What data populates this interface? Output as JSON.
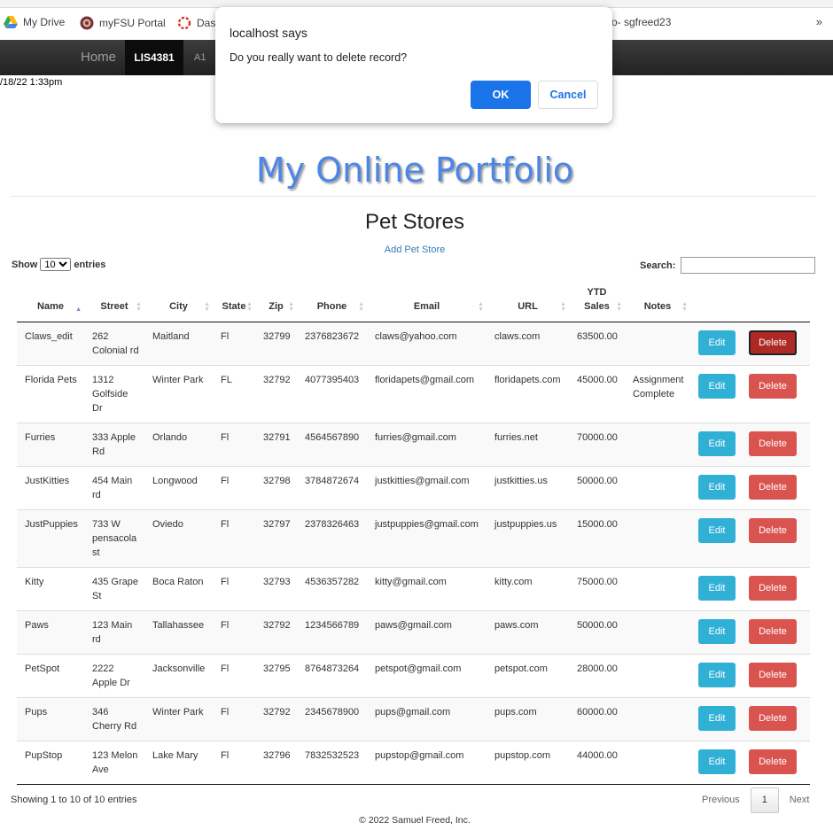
{
  "browser": {
    "bookmarks": [
      {
        "label": "My Drive",
        "icon": "google-drive-icon"
      },
      {
        "label": "myFSU Portal",
        "icon": "fsu-seal-icon"
      },
      {
        "label": "Das",
        "icon": "loading-ring-icon"
      }
    ],
    "bookmark_right_label": "o- sgfreed23",
    "overflow": "»"
  },
  "nav": {
    "home": "Home",
    "active": "LIS4381",
    "a1": "A1"
  },
  "timestamp": "/18/22 1:33pm",
  "dialog": {
    "title": "localhost says",
    "message": "Do you really want to delete record?",
    "ok": "OK",
    "cancel": "Cancel"
  },
  "brand": "My Online Portfolio",
  "page_heading": "Pet Stores",
  "add_link": "Add Pet Store",
  "length": {
    "show": "Show",
    "value": "10",
    "entries": "entries"
  },
  "search": {
    "label": "Search:",
    "value": ""
  },
  "table": {
    "columns": [
      "Name",
      "Street",
      "City",
      "State",
      "Zip",
      "Phone",
      "Email",
      "URL",
      "YTD Sales",
      "Notes"
    ],
    "sorted_column": "Name",
    "edit_label": "Edit",
    "delete_label": "Delete",
    "rows": [
      {
        "name": "Claws_edit",
        "street": "262 Colonial rd",
        "city": "Maitland",
        "state": "Fl",
        "zip": "32799",
        "phone": "2376823672",
        "email": "claws@yahoo.com",
        "url": "claws.com",
        "sales": "63500.00",
        "notes": ""
      },
      {
        "name": "Florida Pets",
        "street": "1312 Golfside Dr",
        "city": "Winter Park",
        "state": "FL",
        "zip": "32792",
        "phone": "4077395403",
        "email": "floridapets@gmail.com",
        "url": "floridapets.com",
        "sales": "45000.00",
        "notes": "Assignment Complete"
      },
      {
        "name": "Furries",
        "street": "333 Apple Rd",
        "city": "Orlando",
        "state": "Fl",
        "zip": "32791",
        "phone": "4564567890",
        "email": "furries@gmail.com",
        "url": "furries.net",
        "sales": "70000.00",
        "notes": ""
      },
      {
        "name": "JustKitties",
        "street": "454 Main rd",
        "city": "Longwood",
        "state": "Fl",
        "zip": "32798",
        "phone": "3784872674",
        "email": "justkitties@gmail.com",
        "url": "justkitties.us",
        "sales": "50000.00",
        "notes": ""
      },
      {
        "name": "JustPuppies",
        "street": "733 W pensacola st",
        "city": "Oviedo",
        "state": "Fl",
        "zip": "32797",
        "phone": "2378326463",
        "email": "justpuppies@gmail.com",
        "url": "justpuppies.us",
        "sales": "15000.00",
        "notes": ""
      },
      {
        "name": "Kitty",
        "street": "435 Grape St",
        "city": "Boca Raton",
        "state": "Fl",
        "zip": "32793",
        "phone": "4536357282",
        "email": "kitty@gmail.com",
        "url": "kitty.com",
        "sales": "75000.00",
        "notes": ""
      },
      {
        "name": "Paws",
        "street": "123 Main rd",
        "city": "Tallahassee",
        "state": "Fl",
        "zip": "32792",
        "phone": "1234566789",
        "email": "paws@gmail.com",
        "url": "paws.com",
        "sales": "50000.00",
        "notes": ""
      },
      {
        "name": "PetSpot",
        "street": "2222 Apple Dr",
        "city": "Jacksonville",
        "state": "Fl",
        "zip": "32795",
        "phone": "8764873264",
        "email": "petspot@gmail.com",
        "url": "petspot.com",
        "sales": "28000.00",
        "notes": ""
      },
      {
        "name": "Pups",
        "street": "346 Cherry Rd",
        "city": "Winter Park",
        "state": "Fl",
        "zip": "32792",
        "phone": "2345678900",
        "email": "pups@gmail.com",
        "url": "pups.com",
        "sales": "60000.00",
        "notes": ""
      },
      {
        "name": "PupStop",
        "street": "123 Melon Ave",
        "city": "Lake Mary",
        "state": "Fl",
        "zip": "32796",
        "phone": "7832532523",
        "email": "pupstop@gmail.com",
        "url": "pupstop.com",
        "sales": "44000.00",
        "notes": ""
      }
    ],
    "active_delete_row": 0
  },
  "info": "Showing 1 to 10 of 10 entries",
  "pagination": {
    "previous": "Previous",
    "current": "1",
    "next": "Next"
  },
  "footer": "© 2022 Samuel Freed, Inc.",
  "colors": {
    "brand": "#4d86e6",
    "edit": "#31b0d5",
    "delete": "#d9534f",
    "dialog_ok": "#1a73e8"
  }
}
